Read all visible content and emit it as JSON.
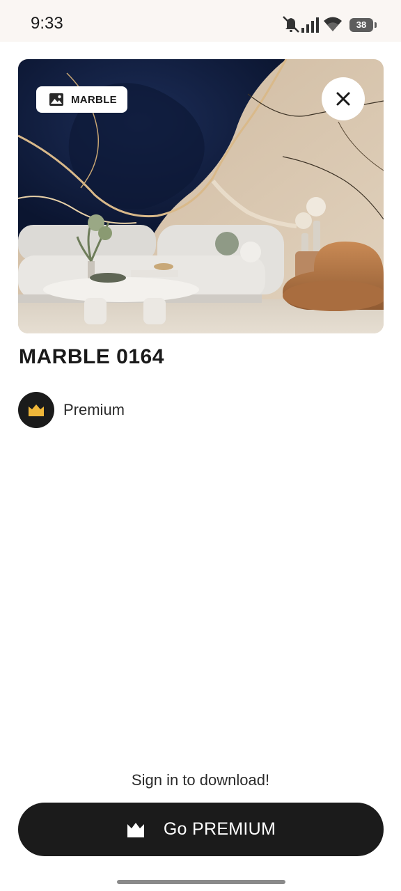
{
  "status_bar": {
    "time": "9:33",
    "battery": "38"
  },
  "hero": {
    "category_label": "MARBLE"
  },
  "wallpaper": {
    "title": "MARBLE 0164",
    "tier_label": "Premium"
  },
  "footer": {
    "sign_in_prompt": "Sign in to download!",
    "cta_label": "Go PREMIUM"
  },
  "colors": {
    "accent_gold": "#f0b73a",
    "dark": "#1b1b1b",
    "background": "#ffffff"
  },
  "icons": [
    "mute-icon",
    "signal-icon",
    "wifi-icon",
    "battery-icon",
    "image-icon",
    "close-icon",
    "crown-icon"
  ]
}
